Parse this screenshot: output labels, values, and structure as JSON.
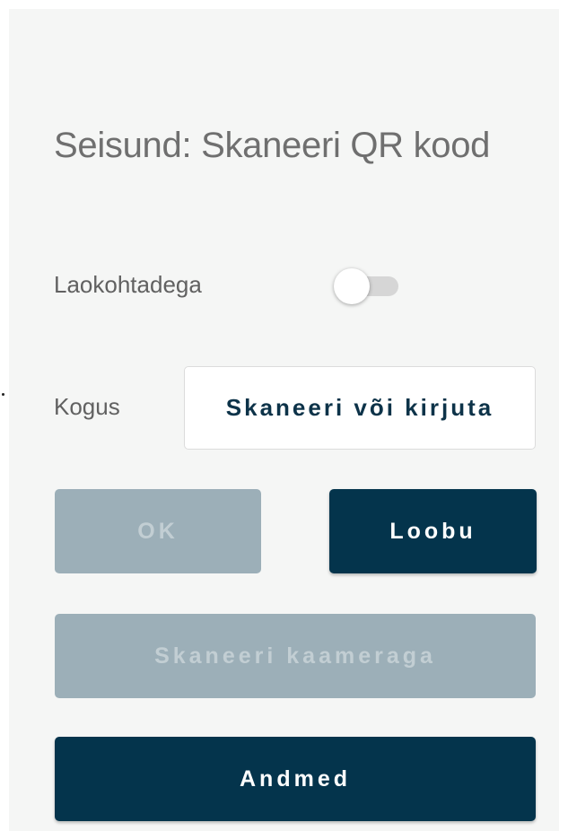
{
  "status": {
    "text": "Seisund: Skaneeri QR kood"
  },
  "location_toggle": {
    "label": "Laokohtadega",
    "checked": false
  },
  "quantity": {
    "label": "Kogus",
    "placeholder": "Skaneeri või kirjuta"
  },
  "buttons": {
    "ok": {
      "label": "OK",
      "enabled": false
    },
    "cancel": {
      "label": "Loobu",
      "enabled": true
    },
    "scan_camera": {
      "label": "Skaneeri kaameraga",
      "enabled": false
    },
    "details": {
      "label": "Andmed",
      "enabled": true
    }
  },
  "colors": {
    "primary": "#04344c",
    "disabled": "#9cafb8",
    "background": "#f5f6f5"
  }
}
